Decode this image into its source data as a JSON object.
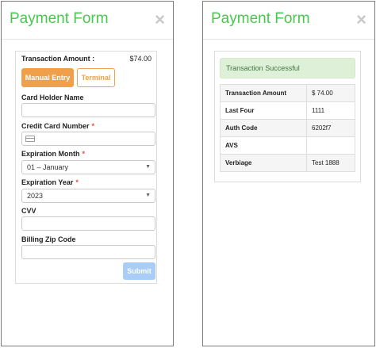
{
  "left": {
    "title": "Payment Form",
    "close": "×",
    "amount_label": "Transaction Amount :",
    "amount_value": "$74.00",
    "tab_manual": "Manual Entry",
    "tab_terminal": "Terminal",
    "card_holder_label": "Card Holder Name",
    "card_holder_value": "",
    "credit_card_label": "Credit Card Number",
    "required_mark": "*",
    "exp_month_label": "Expiration Month",
    "exp_month_value": "01 – January",
    "exp_year_label": "Expiration Year",
    "exp_year_value": "2023",
    "cvv_label": "CVV",
    "zip_label": "Billing Zip Code",
    "submit_label": "Submit",
    "caret": "▼"
  },
  "right": {
    "title": "Payment Form",
    "close": "×",
    "alert": "Transaction Successful",
    "rows": [
      {
        "key": "Transaction Amount",
        "value": "$ 74.00"
      },
      {
        "key": "Last Four",
        "value": "1111"
      },
      {
        "key": "Auth Code",
        "value": "6202f7"
      },
      {
        "key": "AVS",
        "value": ""
      },
      {
        "key": "Verbiage",
        "value": "Test 1888"
      }
    ]
  },
  "colors": {
    "title_green": "#46c94b",
    "accent_orange": "#f0a04b",
    "submit_disabled_blue": "#a9cdf6",
    "success_bg": "#dff0d8"
  }
}
